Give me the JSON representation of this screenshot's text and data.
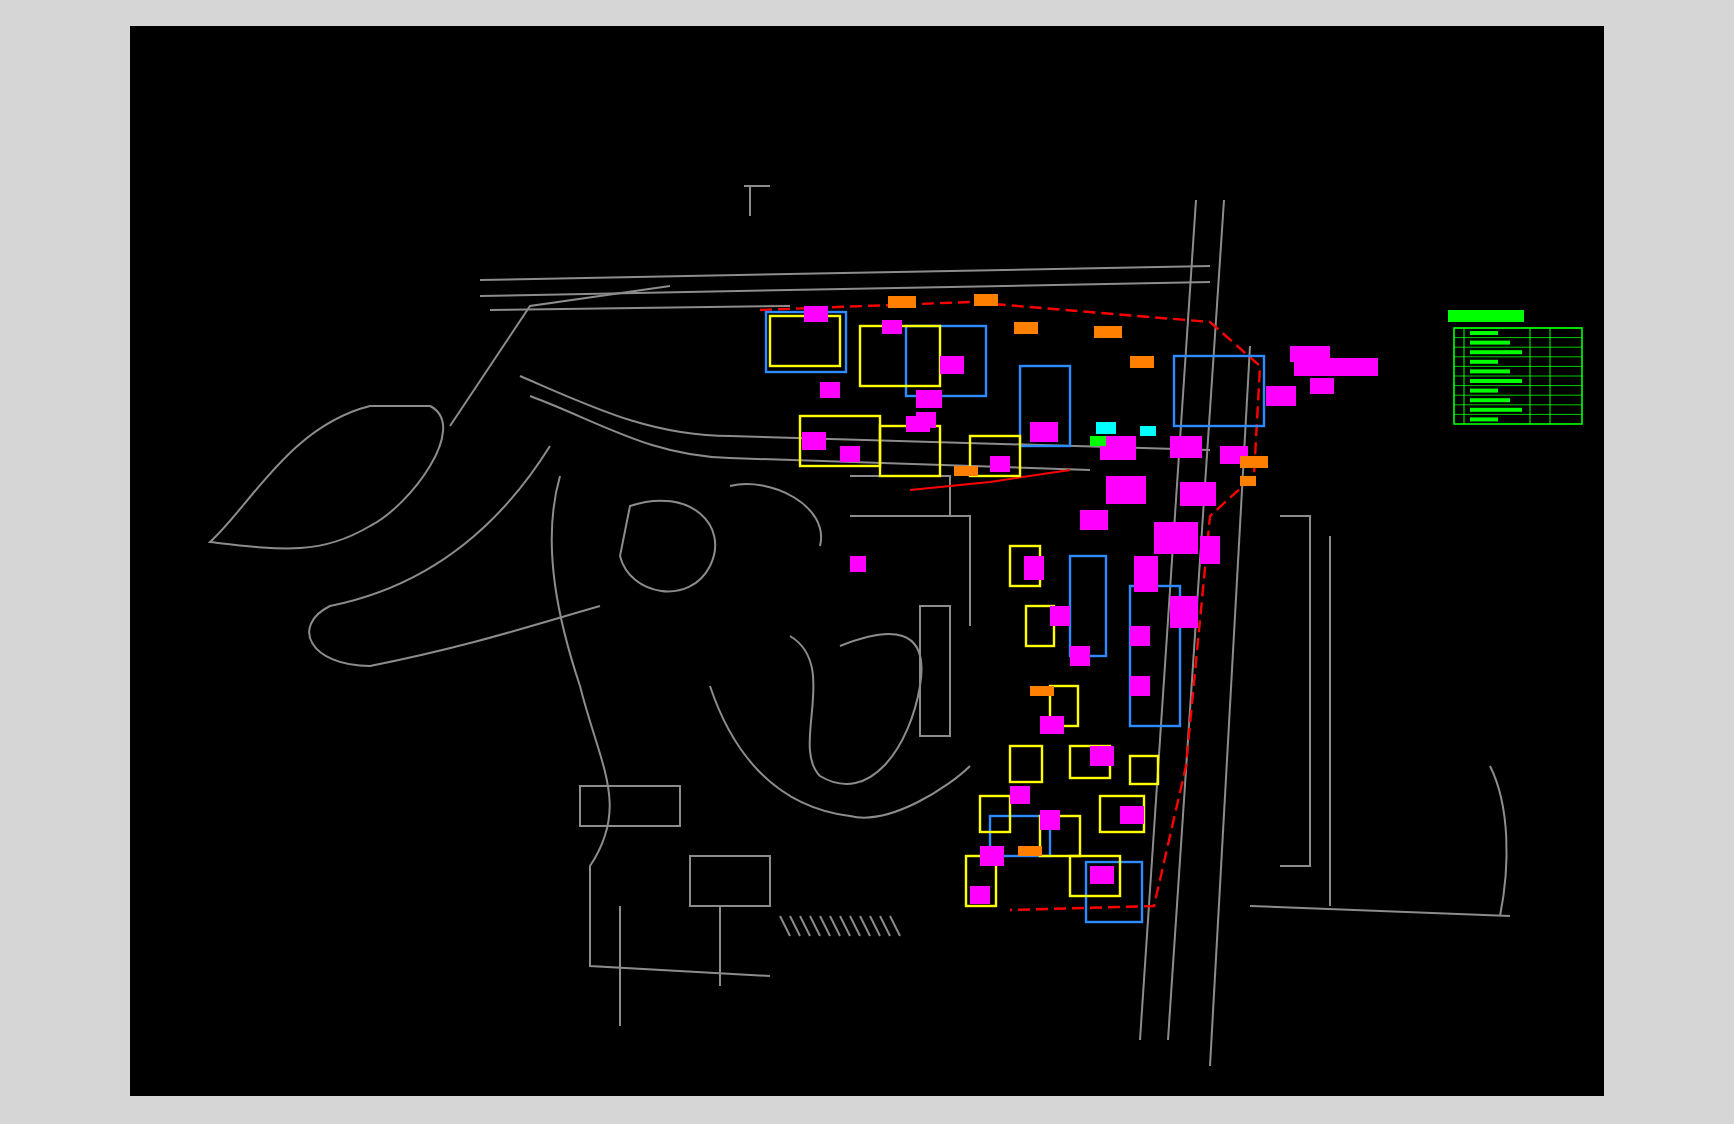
{
  "drawing": {
    "kind": "site-plan"
  },
  "legend": {
    "kind": "table"
  }
}
